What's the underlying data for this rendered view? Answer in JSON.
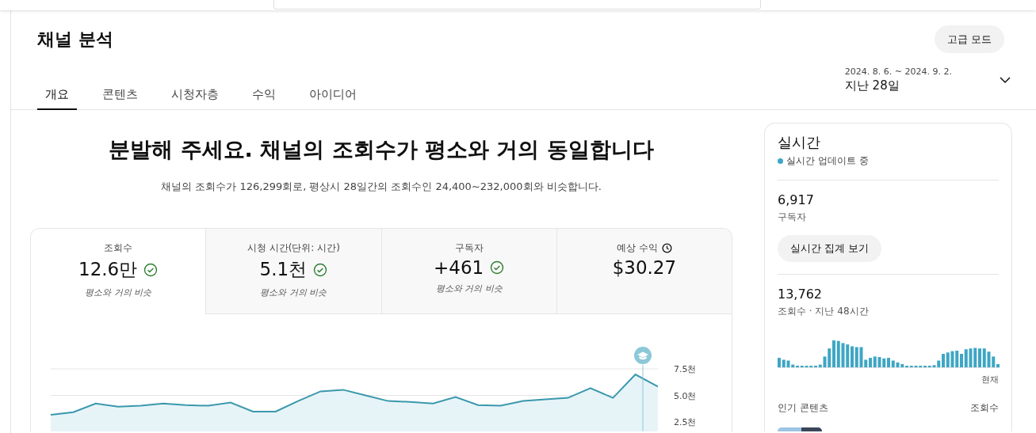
{
  "page_title": "채널 분석",
  "mode_button": "고급 모드",
  "date_range": {
    "dates": "2024. 8. 6. ~ 2024. 9. 2.",
    "label": "지난 28일"
  },
  "tabs": [
    {
      "label": "개요",
      "selected": true
    },
    {
      "label": "콘텐츠",
      "selected": false
    },
    {
      "label": "시청자층",
      "selected": false
    },
    {
      "label": "수익",
      "selected": false
    },
    {
      "label": "아이디어",
      "selected": false
    }
  ],
  "headline": "분발해 주세요. 채널의 조회수가 평소와 거의 동일합니다",
  "summary": "채널의 조회수가 126,299회로, 평상시 28일간의 조회수인 24,400~232,000회와 비슷합니다.",
  "metrics": [
    {
      "kind": "compared",
      "label": "조회수",
      "value": "12.6만",
      "note": "평소와 거의 비슷",
      "selected": true
    },
    {
      "kind": "compared",
      "label": "시청 시간(단위: 시간)",
      "value": "5.1천",
      "note": "평소와 거의 비슷",
      "selected": false
    },
    {
      "kind": "compared",
      "label": "구독자",
      "value": "+461",
      "note": "평소와 거의 비슷",
      "selected": false
    },
    {
      "kind": "estimate",
      "label": "예상 수익",
      "value": "$30.27",
      "selected": false
    }
  ],
  "chart": {
    "chart_data": {
      "type": "area",
      "ylim": [
        2.5,
        7.5
      ],
      "yticks": [
        {
          "value": 2.5,
          "label": "2.5천"
        },
        {
          "value": 5,
          "label": "5.0천"
        },
        {
          "value": 7.5,
          "label": "7.5천"
        }
      ],
      "values": [
        3.18,
        3.41,
        4.24,
        3.94,
        4.02,
        4.24,
        4.09,
        4.02,
        4.32,
        3.48,
        3.48,
        4.47,
        5.38,
        5.53,
        5.0,
        4.47,
        4.39,
        4.24,
        4.85,
        4.09,
        4.02,
        4.47,
        4.62,
        4.77,
        5.68,
        4.77,
        6.97,
        5.83
      ]
    }
  },
  "realtime": {
    "title": "실시간",
    "status": "실시간 업데이트 중",
    "subscribers": "6,917",
    "subscribers_label": "구독자",
    "button": "실시간 집계 보기",
    "views": "13,762",
    "views_label": "조회수 · 지난 48시간",
    "now_label": "현재",
    "top_content_label": "인기 콘텐츠",
    "top_content_metric": "조회수"
  }
}
